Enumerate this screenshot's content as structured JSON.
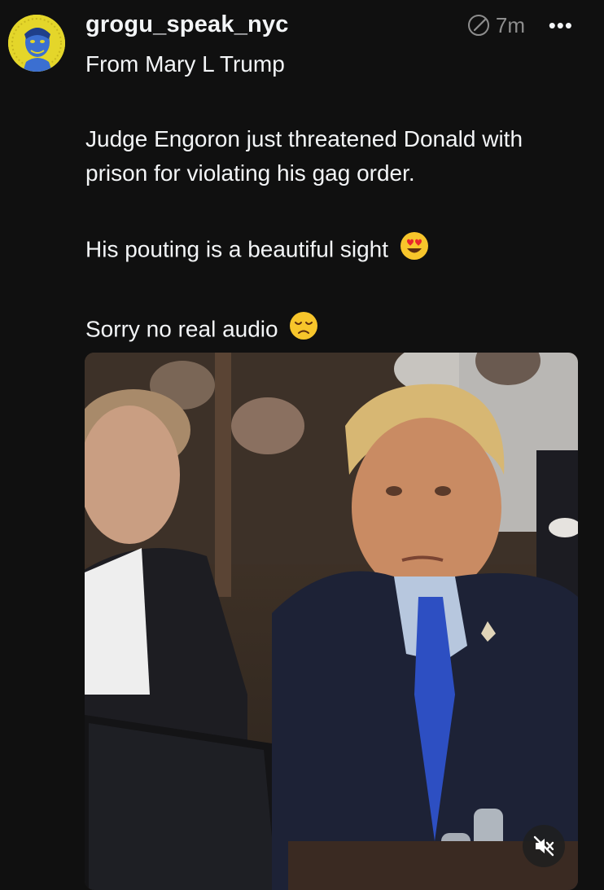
{
  "post": {
    "username": "grogu_speak_nyc",
    "timestamp": "7m",
    "more_label": "•••",
    "lines": {
      "from": "From Mary L Trump",
      "body": "Judge Engoron just threatened Donald with prison for violating his gag order.",
      "pouting": "His pouting is a beautiful sight",
      "audio": "Sorry no real audio"
    },
    "emojis": [
      "heart-eyes-emoji",
      "disappointed-emoji"
    ]
  },
  "media": {
    "type": "video",
    "muted": true,
    "mute_icon": "speaker-muted-icon"
  },
  "colors": {
    "background": "#101010",
    "text": "#f3f5f7",
    "secondary_text": "#8e8e8e",
    "avatar_bg": "#e4d62a",
    "avatar_face": "#3b6fd1"
  }
}
